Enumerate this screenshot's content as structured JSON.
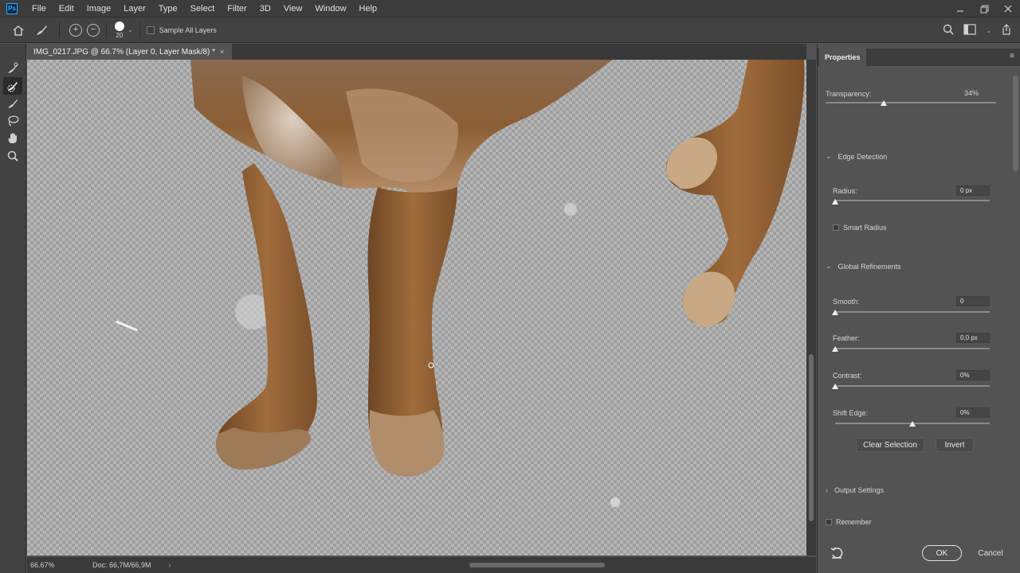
{
  "menu": [
    "File",
    "Edit",
    "Image",
    "Layer",
    "Type",
    "Select",
    "Filter",
    "3D",
    "View",
    "Window",
    "Help"
  ],
  "app_logo": "Ps",
  "options": {
    "brush_size": "20",
    "sample_all_layers": "Sample All Layers"
  },
  "document": {
    "tab_title": "IMG_0217.JPG @ 66.7% (Layer 0, Layer Mask/8) *",
    "close_glyph": "×"
  },
  "status": {
    "zoom": "66.67%",
    "doc_size": "Doc: 66,7M/66,9M"
  },
  "properties": {
    "tab": "Properties",
    "transparency_label": "Transparency:",
    "transparency_value": "34%",
    "transparency_level": 0.34,
    "edge_detection": "Edge Detection",
    "radius_label": "Radius:",
    "radius_value": "0 px",
    "radius_level": 0,
    "smart_radius": "Smart Radius",
    "global_refinements": "Global Refinements",
    "smooth_label": "Smooth:",
    "smooth_value": "0",
    "smooth_level": 0,
    "feather_label": "Feather:",
    "feather_value": "0,0 px",
    "feather_level": 0,
    "contrast_label": "Contrast:",
    "contrast_value": "0%",
    "contrast_level": 0,
    "shift_edge_label": "Shift Edge:",
    "shift_edge_value": "0%",
    "shift_edge_level": 0.5,
    "clear_selection": "Clear Selection",
    "invert": "Invert",
    "output_settings": "Output Settings",
    "remember": "Remember",
    "ok": "OK",
    "cancel": "Cancel"
  },
  "colors": {
    "panel_bg": "#535353",
    "bar_bg": "#424242",
    "accent": "#31a8ff"
  }
}
